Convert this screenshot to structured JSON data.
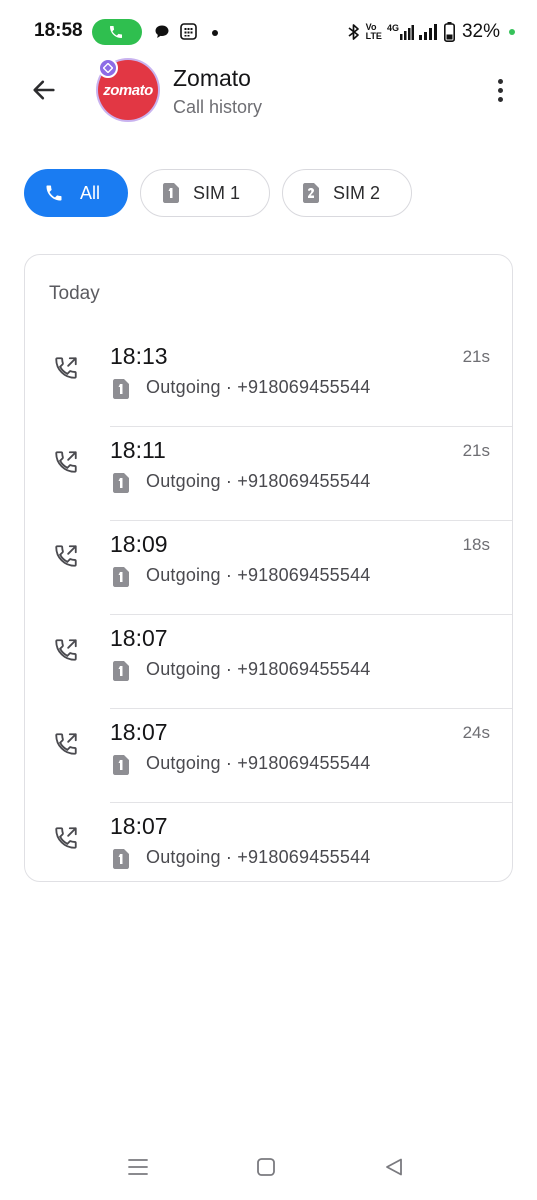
{
  "status_bar": {
    "time": "18:58",
    "network_small_top": "Vo",
    "network_small_bottom": "LTE",
    "network_type": "4G",
    "battery_percent": "32%",
    "icons": [
      "call-active-icon",
      "chat-bubble-icon",
      "calendar-grid-icon",
      "notification-dot",
      "bluetooth-icon",
      "volte-icon",
      "signal-4g-icon",
      "signal-icon",
      "battery-icon"
    ]
  },
  "header": {
    "contact_name": "Zomato",
    "subtitle": "Call history",
    "avatar_text": "zomato",
    "avatar_color": "#e23744",
    "badge_color": "#8d6ce6"
  },
  "filters": {
    "chips": [
      {
        "label": "All",
        "icon": "phone-icon",
        "selected": true
      },
      {
        "label": "SIM 1",
        "icon": "sim1-icon",
        "selected": false
      },
      {
        "label": "SIM 2",
        "icon": "sim2-icon",
        "selected": false
      }
    ],
    "accent_color": "#1a7cf2"
  },
  "history": {
    "section_title": "Today",
    "calls": [
      {
        "time": "18:13",
        "duration": "21s",
        "detail": "Outgoing · +918069455544",
        "sim": "1"
      },
      {
        "time": "18:11",
        "duration": "21s",
        "detail": "Outgoing · +918069455544",
        "sim": "1"
      },
      {
        "time": "18:09",
        "duration": "18s",
        "detail": "Outgoing · +918069455544",
        "sim": "1"
      },
      {
        "time": "18:07",
        "duration": "",
        "detail": "Outgoing · +918069455544",
        "sim": "1"
      },
      {
        "time": "18:07",
        "duration": "24s",
        "detail": "Outgoing · +918069455544",
        "sim": "1"
      },
      {
        "time": "18:07",
        "duration": "",
        "detail": "Outgoing · +918069455544",
        "sim": "1"
      }
    ]
  },
  "nav_bar": {
    "buttons": [
      "menu-icon",
      "home-icon",
      "back-triangle-icon"
    ]
  }
}
